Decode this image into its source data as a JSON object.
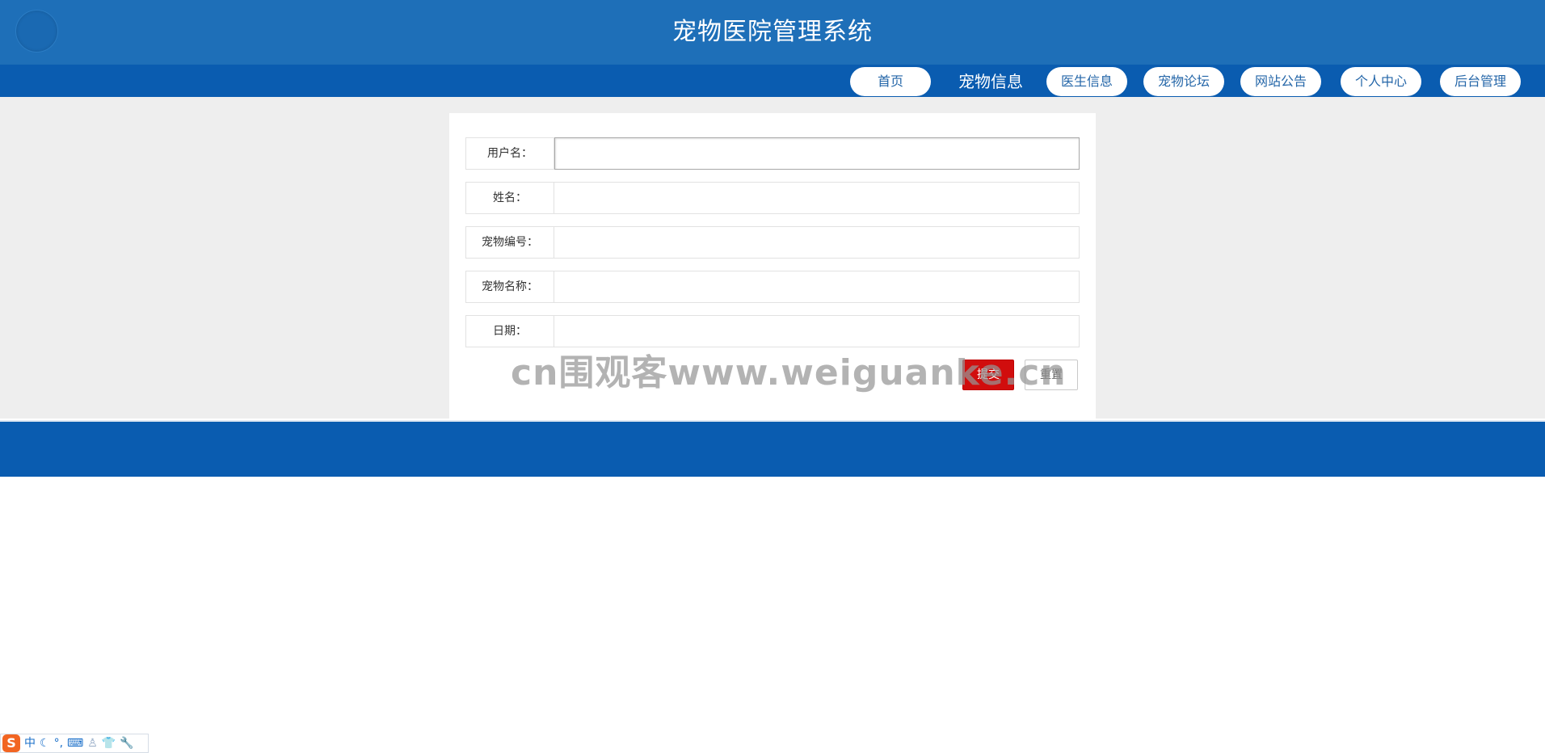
{
  "header": {
    "title": "宠物医院管理系统"
  },
  "nav": {
    "items": [
      {
        "label": "首页"
      },
      {
        "label": "宠物信息"
      },
      {
        "label": "医生信息"
      },
      {
        "label": "宠物论坛"
      },
      {
        "label": "网站公告"
      },
      {
        "label": "个人中心"
      },
      {
        "label": "后台管理"
      }
    ],
    "active": "宠物信息"
  },
  "form": {
    "fields": [
      {
        "label": "用户名：",
        "value": ""
      },
      {
        "label": "姓名：",
        "value": ""
      },
      {
        "label": "宠物编号：",
        "value": ""
      },
      {
        "label": "宠物名称：",
        "value": ""
      },
      {
        "label": "日期：",
        "value": ""
      }
    ],
    "submit_label": "提交",
    "reset_label": "重置"
  },
  "watermark": "cn围观客www.weiguanke.cn",
  "ime_toolbar": {
    "logo": "S",
    "mode": "中",
    "icons": [
      "moon-icon",
      "punctuation-icon",
      "keyboard-icon",
      "user-icon",
      "shirt-icon",
      "wrench-icon"
    ]
  },
  "colors": {
    "header_bg": "#1e6fb8",
    "nav_bg": "#0a5cb0",
    "submit_bg": "#d10d0d",
    "page_bg": "#eeeeee"
  }
}
